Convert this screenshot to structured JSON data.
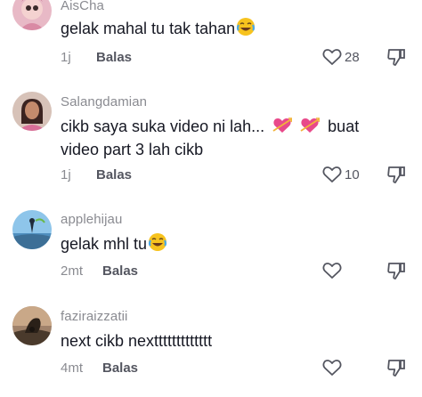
{
  "comments": [
    {
      "username": "AisCha",
      "text": "gelak mahal tu tak tahan",
      "emoji": "laughing-tears",
      "time": "1j",
      "reply_label": "Balas",
      "likes": "28"
    },
    {
      "username": "Salangdamian",
      "text_line1": "cikb saya suka video ni lah...",
      "text_after_emoji": "buat",
      "text_line2": "video part 3 lah cikb",
      "emoji": "heart-with-arrow",
      "time": "1j",
      "reply_label": "Balas",
      "likes": "10"
    },
    {
      "username": "applehijau",
      "text": "gelak mhl tu",
      "emoji": "laughing-tears",
      "time": "2mt",
      "reply_label": "Balas",
      "likes": ""
    },
    {
      "username": "faziraizzatii",
      "text": "next cikb nexttttttttttttt",
      "time": "4mt",
      "reply_label": "Balas",
      "likes": ""
    }
  ],
  "colors": {
    "text_primary": "#161823",
    "text_secondary": "#8a8b91",
    "icon": "#545660"
  }
}
